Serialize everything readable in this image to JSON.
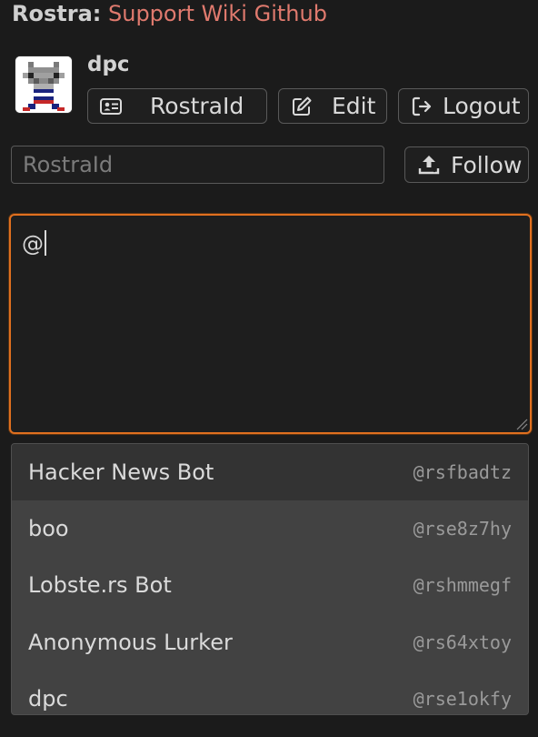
{
  "topbar": {
    "brand": "Rostra:",
    "links": [
      "Support",
      "Wiki",
      "Github"
    ]
  },
  "profile": {
    "username": "dpc",
    "avatar_alt": "pixel-art avatar"
  },
  "buttons": {
    "rostraid_label": "RostraId",
    "edit_label": "Edit",
    "logout_label": "Logout",
    "follow_label": "Follow"
  },
  "follow_input": {
    "placeholder": "RostraId",
    "value": ""
  },
  "composer": {
    "value": "@"
  },
  "suggestions": [
    {
      "name": "Hacker News Bot",
      "handle": "@rsfbadtz"
    },
    {
      "name": "boo",
      "handle": "@rse8z7hy"
    },
    {
      "name": "Lobste.rs Bot",
      "handle": "@rshmmegf"
    },
    {
      "name": "Anonymous Lurker",
      "handle": "@rs64xtoy"
    },
    {
      "name": "dpc",
      "handle": "@rse1okfy"
    }
  ],
  "colors": {
    "link": "#e07a6e",
    "focus_border": "#e0701f",
    "background": "#1b1b1b",
    "suggest_bg": "#424242",
    "suggest_active_bg": "#333333"
  },
  "icons": [
    "id-card-icon",
    "edit-icon",
    "logout-icon",
    "upload-icon",
    "resize-handle-icon"
  ]
}
